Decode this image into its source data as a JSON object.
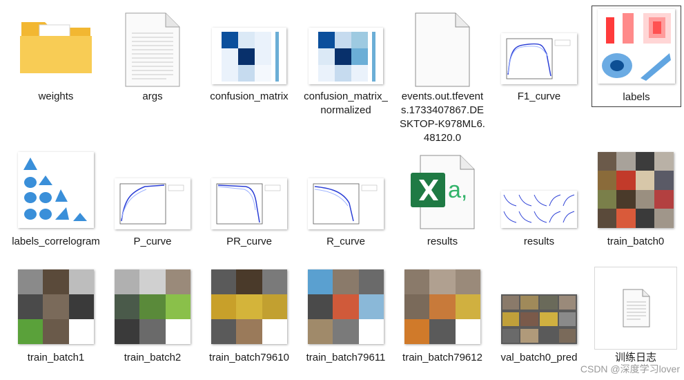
{
  "files": [
    {
      "name": "weights"
    },
    {
      "name": "args"
    },
    {
      "name": "confusion_matrix"
    },
    {
      "name": "confusion_matrix_normalized"
    },
    {
      "name": "events.out.tfevents.1733407867.DESKTOP-K978ML6.48120.0"
    },
    {
      "name": "F1_curve"
    },
    {
      "name": "labels"
    },
    {
      "name": "labels_correlogram"
    },
    {
      "name": "P_curve"
    },
    {
      "name": "PR_curve"
    },
    {
      "name": "R_curve"
    },
    {
      "name": "results"
    },
    {
      "name": "results"
    },
    {
      "name": "train_batch0"
    },
    {
      "name": "train_batch1"
    },
    {
      "name": "train_batch2"
    },
    {
      "name": "train_batch79610"
    },
    {
      "name": "train_batch79611"
    },
    {
      "name": "train_batch79612"
    },
    {
      "name": "val_batch0_pred"
    },
    {
      "name": "训练日志"
    }
  ],
  "watermark": "CSDN @深度学习lover",
  "colors": {
    "folder": "#f5c543",
    "excel": "#1f7a44",
    "curve": "#2b3fd6",
    "matrix": "#0b4f9c"
  }
}
